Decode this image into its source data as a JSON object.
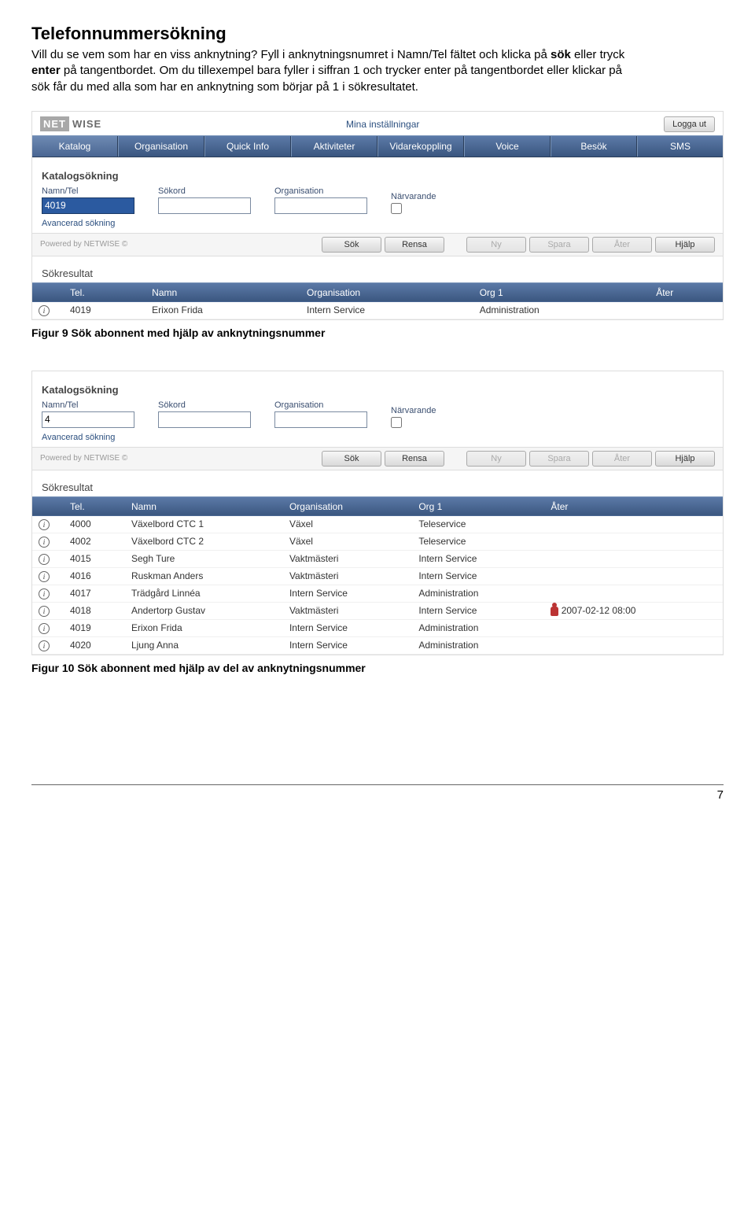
{
  "doc": {
    "title": "Telefonnummersökning",
    "intro_1": "Vill du se vem som har en viss anknytning? Fyll i anknytningsnumret i Namn/Tel fältet och klicka på ",
    "intro_sok": "sök",
    "intro_2": " eller tryck ",
    "intro_enter": "enter",
    "intro_3": " på tangentbordet. Om du tillexempel bara fyller i siffran 1 och trycker enter på tangentbordet eller klickar på sök får du med alla som har en anknytning som börjar på 1 i sökresultatet.",
    "caption1": "Figur 9  Sök abonnent med hjälp av anknytningsnummer",
    "caption2": "Figur 10  Sök abonnent med hjälp av del av anknytningsnummer",
    "page_num": "7"
  },
  "logo": {
    "net": "NET",
    "wise": "WISE"
  },
  "top": {
    "settings": "Mina inställningar",
    "logout": "Logga ut"
  },
  "tabs": [
    "Katalog",
    "Organisation",
    "Quick Info",
    "Aktiviteter",
    "Vidarekoppling",
    "Voice",
    "Besök",
    "SMS"
  ],
  "search": {
    "heading": "Katalogsökning",
    "labels": {
      "namn": "Namn/Tel",
      "sokord": "Sökord",
      "org": "Organisation",
      "narv": "Närvarande"
    },
    "advanced": "Avancerad sökning",
    "value1": "4019",
    "value2": "4"
  },
  "actions": {
    "powered": "Powered by NETWISE ©",
    "sok": "Sök",
    "rensa": "Rensa",
    "ny": "Ny",
    "spara": "Spara",
    "ater": "Åter",
    "hjalp": "Hjälp"
  },
  "results": {
    "heading": "Sökresultat",
    "cols5": [
      "Tel.",
      "Namn",
      "Organisation",
      "Org 1",
      "Åter"
    ],
    "rows1": [
      {
        "tel": "4019",
        "namn": "Erixon Frida",
        "org": "Intern Service",
        "org1": "Administration",
        "ater": ""
      }
    ],
    "rows2": [
      {
        "tel": "4000",
        "namn": "Växelbord CTC 1",
        "org": "Växel",
        "org1": "Teleservice",
        "ater": ""
      },
      {
        "tel": "4002",
        "namn": "Växelbord CTC 2",
        "org": "Växel",
        "org1": "Teleservice",
        "ater": ""
      },
      {
        "tel": "4015",
        "namn": "Segh Ture",
        "org": "Vaktmästeri",
        "org1": "Intern Service",
        "ater": ""
      },
      {
        "tel": "4016",
        "namn": "Ruskman Anders",
        "org": "Vaktmästeri",
        "org1": "Intern Service",
        "ater": ""
      },
      {
        "tel": "4017",
        "namn": "Trädgård Linnéa",
        "org": "Intern Service",
        "org1": "Administration",
        "ater": ""
      },
      {
        "tel": "4018",
        "namn": "Andertorp Gustav",
        "org": "Vaktmästeri",
        "org1": "Intern Service",
        "ater": "2007-02-12 08:00",
        "icon": true
      },
      {
        "tel": "4019",
        "namn": "Erixon Frida",
        "org": "Intern Service",
        "org1": "Administration",
        "ater": ""
      },
      {
        "tel": "4020",
        "namn": "Ljung Anna",
        "org": "Intern Service",
        "org1": "Administration",
        "ater": ""
      }
    ]
  }
}
